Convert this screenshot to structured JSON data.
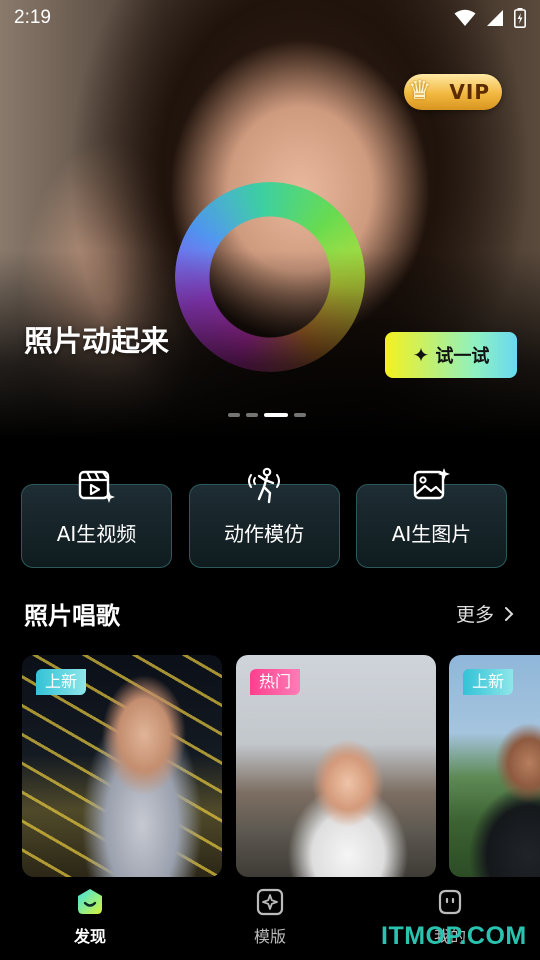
{
  "status_bar": {
    "time": "2:19"
  },
  "hero": {
    "title": "照片动起来",
    "vip_label": "VIP",
    "cta_label": "试一试",
    "carousel": {
      "count": 4,
      "active_index": 2
    }
  },
  "features": [
    {
      "label": "AI生视频",
      "icon": "video-spark-icon"
    },
    {
      "label": "动作模仿",
      "icon": "dance-figure-icon"
    },
    {
      "label": "AI生图片",
      "icon": "image-spark-icon"
    }
  ],
  "section": {
    "title": "照片唱歌",
    "more_label": "更多",
    "cards": [
      {
        "tag": "上新",
        "tag_color": "#32c2d6"
      },
      {
        "tag": "热门",
        "tag_color": "#ff3f8e"
      },
      {
        "tag": "上新",
        "tag_color": "#32c2d6"
      }
    ]
  },
  "nav": {
    "items": [
      {
        "label": "发现",
        "icon": "discover-icon",
        "active": true
      },
      {
        "label": "模版",
        "icon": "template-icon",
        "active": false
      },
      {
        "label": "我的",
        "icon": "profile-icon",
        "active": false
      }
    ]
  },
  "watermark": "ITMOP.COM",
  "colors": {
    "accent_teal": "#2c5a5c",
    "cta_yellow": "#f4f11f",
    "vip_gold": "#f2b840"
  }
}
